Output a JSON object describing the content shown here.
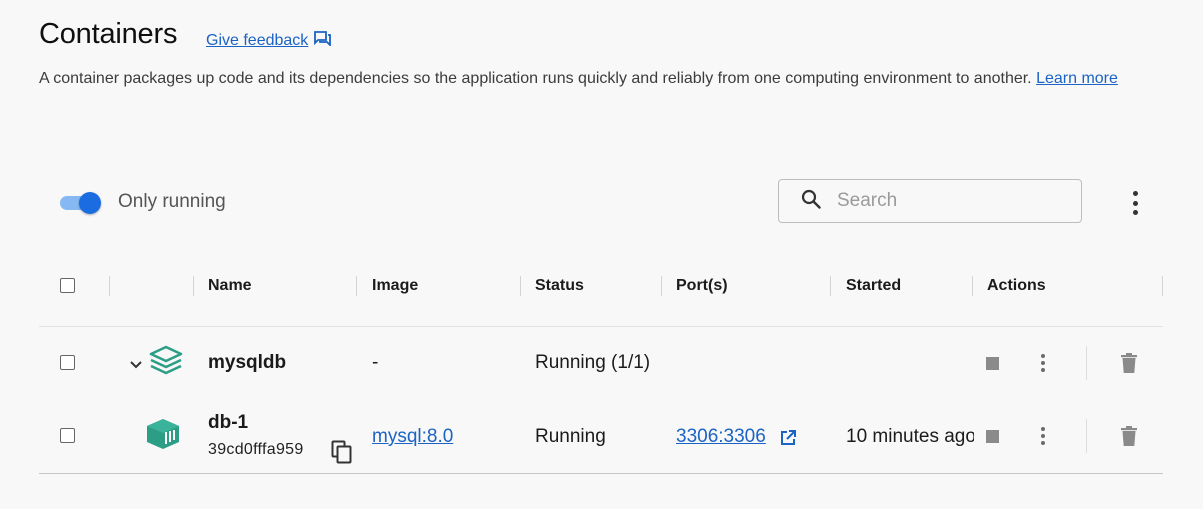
{
  "header": {
    "title": "Containers",
    "feedback_label": "Give feedback",
    "description": "A container packages up code and its dependencies so the application runs quickly and reliably from one computing environment to another.",
    "learn_more_label": "Learn more"
  },
  "toolbar": {
    "only_running_label": "Only running",
    "only_running_on": true,
    "search_placeholder": "Search"
  },
  "table": {
    "columns": [
      "Name",
      "Image",
      "Status",
      "Port(s)",
      "Started",
      "Actions"
    ],
    "rows": [
      {
        "name": "mysqldb",
        "image": "-",
        "status": "Running (1/1)",
        "ports": "",
        "started": "",
        "type": "compose-stack"
      },
      {
        "name": "db-1",
        "id": "39cd0fffa959",
        "image": "mysql:8.0",
        "status": "Running",
        "ports": "3306:3306",
        "started": "10 minutes ago",
        "type": "container"
      }
    ]
  },
  "colors": {
    "accent": "#1a6ce0",
    "link": "#1b63c4",
    "container_icon": "#2c9e86"
  },
  "icons": [
    "feedback-icon",
    "search-icon",
    "more-vert-icon",
    "chevron-down-icon",
    "stack-icon",
    "container-icon",
    "copy-icon",
    "external-link-icon",
    "stop-icon",
    "trash-icon"
  ]
}
